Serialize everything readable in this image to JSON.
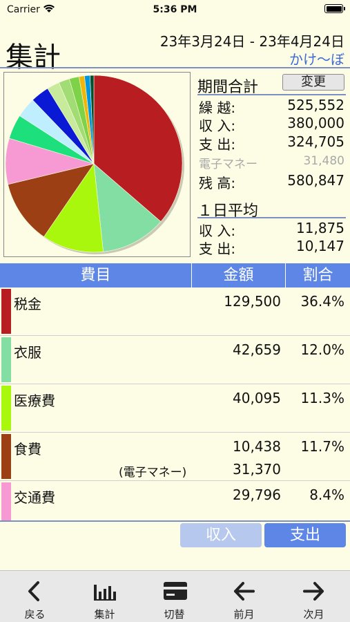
{
  "status_bar": {
    "carrier": "Carrier",
    "time": "5:36 PM"
  },
  "header": {
    "title": "集計",
    "period": "23年3月24日 - 23年4月24日",
    "account": "かけ〜ぼ"
  },
  "summary": {
    "title": "期間合計",
    "change_button": "変更",
    "rows": [
      {
        "label": "繰 越:",
        "value": "525,552"
      },
      {
        "label": "収 入:",
        "value": "380,000"
      },
      {
        "label": "支 出:",
        "value": "324,705"
      },
      {
        "label": "電子マネー",
        "value": "31,480"
      },
      {
        "label": "残 高:",
        "value": "580,847"
      }
    ],
    "daily_title": "１日平均",
    "daily_rows": [
      {
        "label": "収 入:",
        "value": "11,875"
      },
      {
        "label": "支 出:",
        "value": "10,147"
      }
    ]
  },
  "table": {
    "headers": {
      "category": "費目",
      "amount": "金額",
      "ratio": "割合"
    },
    "rows": [
      {
        "category": "税金",
        "amount": "129,500",
        "ratio": "36.4%",
        "color": "#b81d22"
      },
      {
        "category": "衣服",
        "amount": "42,659",
        "ratio": "12.0%",
        "color": "#83dea4"
      },
      {
        "category": "医療費",
        "amount": "40,095",
        "ratio": "11.3%",
        "color": "#a8f70c"
      },
      {
        "category": "食費",
        "amount": "10,438",
        "ratio": "11.7%",
        "color": "#9d3f15",
        "sub_label": "(電子マネー)",
        "sub_amount": "31,370"
      },
      {
        "category": "交通費",
        "amount": "29,796",
        "ratio": "8.4%",
        "color": "#f79ad3"
      }
    ]
  },
  "segments": {
    "income": "収入",
    "expense": "支出"
  },
  "tabs": [
    {
      "label": "戻る",
      "icon": "chevron-left-icon"
    },
    {
      "label": "集計",
      "icon": "bar-chart-icon"
    },
    {
      "label": "切替",
      "icon": "card-icon"
    },
    {
      "label": "前月",
      "icon": "arrow-left-icon"
    },
    {
      "label": "次月",
      "icon": "arrow-right-icon"
    }
  ],
  "chart_data": {
    "type": "pie",
    "slices": [
      {
        "label": "税金",
        "value": 36.4,
        "color": "#b81d22"
      },
      {
        "label": "衣服",
        "value": 12.0,
        "color": "#83dea4"
      },
      {
        "label": "医療費",
        "value": 11.3,
        "color": "#a8f70c"
      },
      {
        "label": "食費",
        "value": 11.7,
        "color": "#9d3f15"
      },
      {
        "label": "交通費",
        "value": 8.4,
        "color": "#f79ad3"
      },
      {
        "label": "",
        "value": 4.5,
        "color": "#1de07c"
      },
      {
        "label": "",
        "value": 3.7,
        "color": "#bfeefe"
      },
      {
        "label": "",
        "value": 3.4,
        "color": "#0a19d4"
      },
      {
        "label": "",
        "value": 2.3,
        "color": "#c8eb9b"
      },
      {
        "label": "",
        "value": 2.0,
        "color": "#a1dc75"
      },
      {
        "label": "",
        "value": 1.8,
        "color": "#7ed248"
      },
      {
        "label": "",
        "value": 1.0,
        "color": "#f0b70b"
      },
      {
        "label": "",
        "value": 1.0,
        "color": "#0096e0"
      },
      {
        "label": "",
        "value": 0.7,
        "color": "#0a4f2c"
      }
    ]
  }
}
